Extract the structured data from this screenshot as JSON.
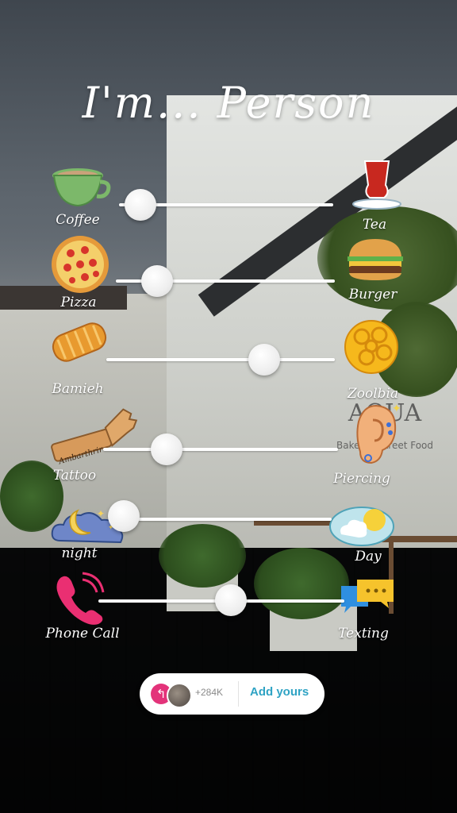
{
  "title": "I'm... Person",
  "rows": [
    {
      "left_label": "Coffee",
      "right_label": "Tea",
      "left_icon": "coffee-cup-icon",
      "right_icon": "tea-glass-icon",
      "slider_position": 0.1
    },
    {
      "left_label": "Pizza",
      "right_label": "Burger",
      "left_icon": "pizza-icon",
      "right_icon": "burger-icon",
      "slider_position": 0.19
    },
    {
      "left_label": "Bamieh",
      "right_label": "Zoolbia",
      "left_icon": "bamieh-icon",
      "right_icon": "zoolbia-icon",
      "slider_position": 0.69
    },
    {
      "left_label": "Tattoo",
      "right_label": "Piercing",
      "left_icon": "tattooed-arm-icon",
      "right_icon": "pierced-ear-icon",
      "slider_position": 0.27
    },
    {
      "left_label": "night",
      "right_label": "Day",
      "left_icon": "moon-night-icon",
      "right_icon": "sun-cloud-icon",
      "slider_position": 0.03
    },
    {
      "left_label": "Phone Call",
      "right_label": "Texting",
      "left_icon": "phone-icon",
      "right_icon": "chat-bubbles-icon",
      "slider_position": 0.54
    }
  ],
  "tattoo_text": "Ambarthrir",
  "add_yours": {
    "count": "+284K",
    "label": "Add yours"
  },
  "background_sign": {
    "brand": "AQUA",
    "tagline": "Bakery · Street Food"
  },
  "colors": {
    "text": "#ffffff",
    "accent_pink": "#e3337a",
    "add_yours_blue": "#2fa3c4"
  }
}
